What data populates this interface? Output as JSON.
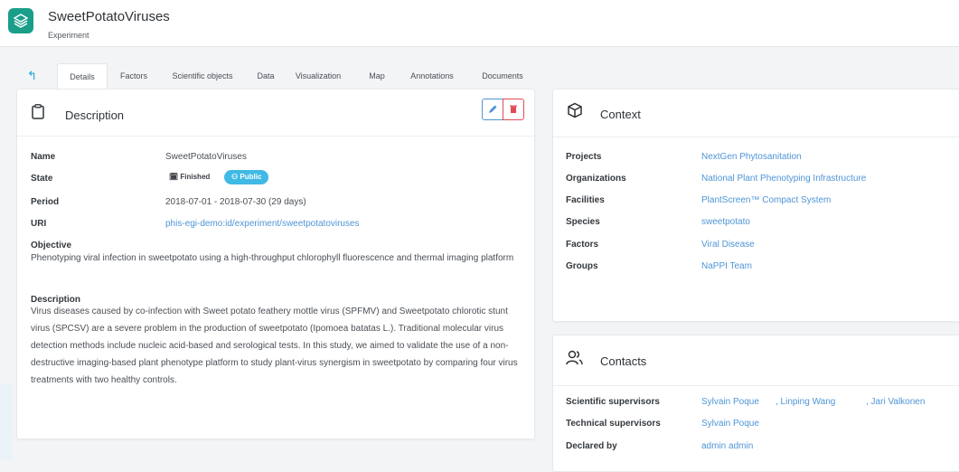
{
  "header": {
    "title": "SweetPotatoViruses",
    "subtitle": "Experiment"
  },
  "tabs": [
    {
      "label": "Details"
    },
    {
      "label": "Factors"
    },
    {
      "label": "Scientific objects"
    },
    {
      "label": "Data"
    },
    {
      "label": "Visualization"
    },
    {
      "label": "Map"
    },
    {
      "label": "Annotations"
    },
    {
      "label": "Documents"
    }
  ],
  "description": {
    "title": "Description",
    "name_label": "Name",
    "name": "SweetPotatoViruses",
    "state_label": "State",
    "state_finished": "Finished",
    "state_public": "Public",
    "period_label": "Period",
    "period": "2018-07-01 - 2018-07-30 (29 days)",
    "uri_label": "URI",
    "uri": "phis-egi-demo:id/experiment/sweetpotatoviruses",
    "objective_label": "Objective",
    "objective": "Phenotyping viral infection in sweetpotato using a high-throughput chlorophyll fluorescence and thermal imaging platform",
    "desc_label": "Description",
    "desc": "Virus diseases caused by co-infection with Sweet potato feathery mottle virus (SPFMV) and Sweetpotato chlorotic stunt virus (SPCSV) are a severe problem in the production of sweetpotato (Ipomoea batatas L.). Traditional molecular virus detection methods include nucleic acid-based and serological tests. In this study, we aimed to validate the use of a non-destructive imaging-based plant phenotype platform to study plant-virus synergism in sweetpotato by comparing four virus treatments with two healthy controls."
  },
  "context": {
    "title": "Context",
    "rows": [
      {
        "label": "Projects",
        "value": "NextGen Phytosanitation"
      },
      {
        "label": "Organizations",
        "value": "National Plant Phenotyping Infrastructure"
      },
      {
        "label": "Facilities",
        "value": "PlantScreen™ Compact System"
      },
      {
        "label": "Species",
        "value": "sweetpotato"
      },
      {
        "label": "Factors",
        "value": "Viral Disease"
      },
      {
        "label": "Groups",
        "value": "NaPPI Team"
      }
    ]
  },
  "contacts": {
    "title": "Contacts",
    "sci_label": "Scientific supervisors",
    "sci": [
      "Sylvain Poque",
      ", Linping Wang",
      ", Jari Valkonen"
    ],
    "tech_label": "Technical supervisors",
    "tech": "Sylvain Poque",
    "declared_label": "Declared by",
    "declared": "admin admin"
  },
  "colors": {
    "brand": "#1a9e8a",
    "link": "#4f95d6",
    "public_badge": "#40b9e4",
    "delete": "#e14b56"
  }
}
